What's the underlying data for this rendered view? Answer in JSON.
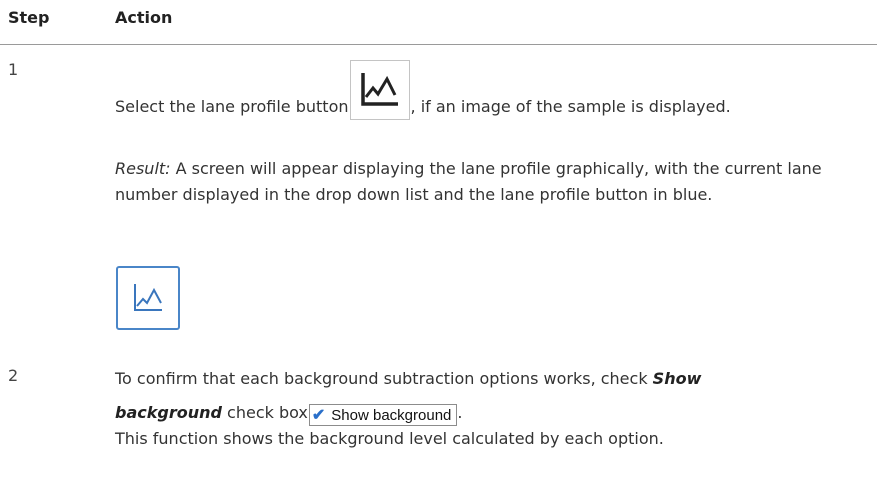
{
  "table": {
    "header": {
      "step": "Step",
      "action": "Action"
    }
  },
  "steps": [
    {
      "number": "1",
      "text_before_icon": "Select the lane profile button",
      "text_after_icon": ", if an image of the sample is displayed.",
      "icon_name": "lane-profile-icon",
      "result_label": "Result:",
      "result_text": " A screen will appear displaying the lane profile graphically, with the current lane number displayed in the drop down list and the lane profile button in blue.",
      "active_icon_name": "lane-profile-icon",
      "active_icon_color": "#4a86c8"
    },
    {
      "number": "2",
      "line1": "To confirm that each background subtraction options works, check ",
      "bold1": "Show",
      "bold2": "background",
      "text_before_checkbox": " check box",
      "checkbox_label": "Show background",
      "checkbox_checked": true,
      "text_after_checkbox": ".",
      "line3": "This function shows the background level calculated by each option."
    }
  ]
}
